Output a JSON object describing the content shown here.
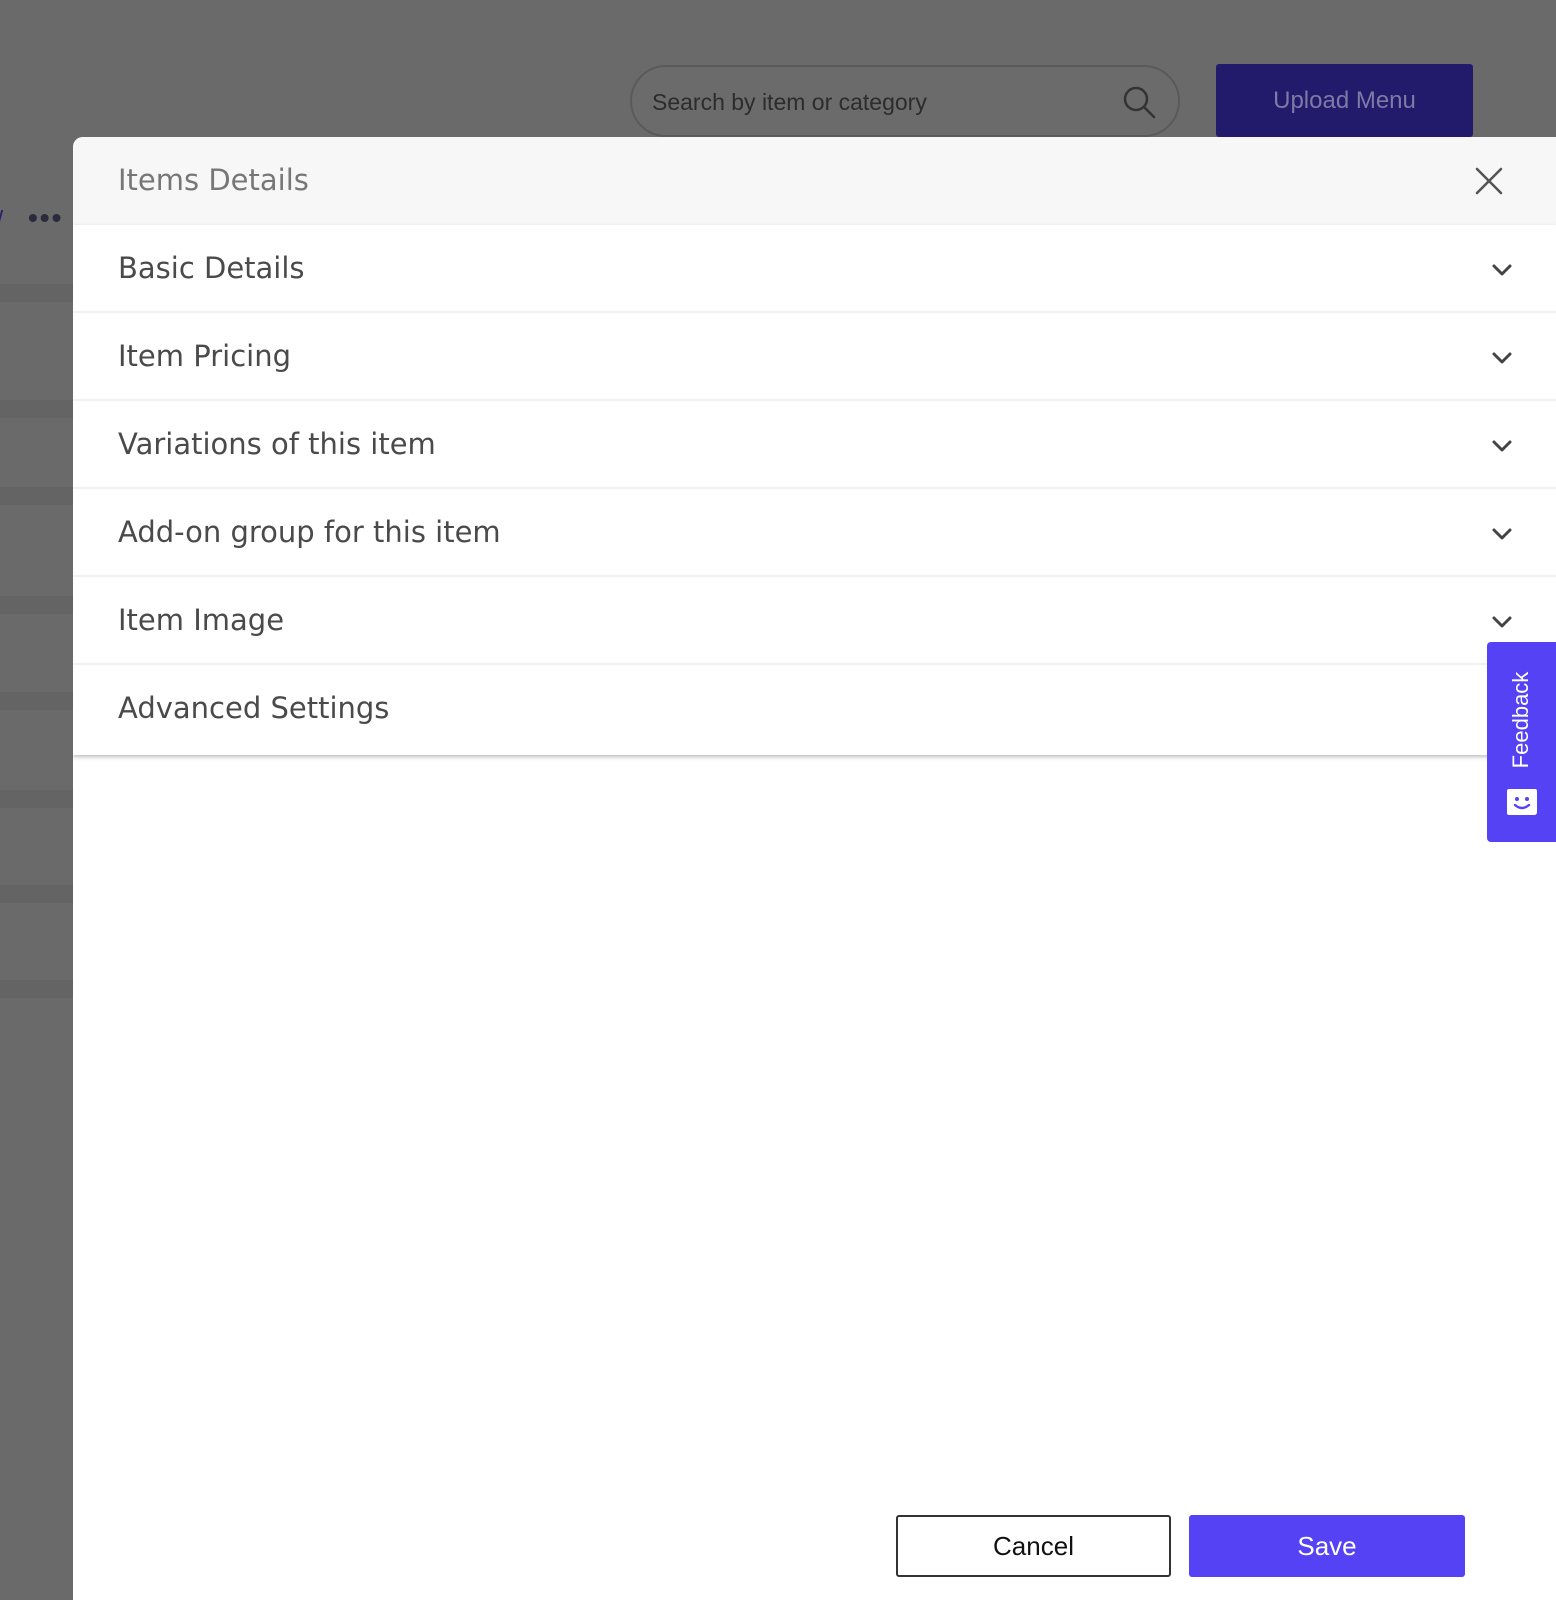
{
  "background": {
    "search": {
      "placeholder": "Search by item or category",
      "icon": "search-icon"
    },
    "upload_button": "Upload Menu",
    "more_icon": "ellipsis-icon"
  },
  "modal": {
    "title": "Items Details",
    "close_icon": "close-icon",
    "sections": [
      {
        "label": "Basic Details",
        "icon": "chevron-down-icon"
      },
      {
        "label": "Item Pricing",
        "icon": "chevron-down-icon"
      },
      {
        "label": "Variations of this item",
        "icon": "chevron-down-icon"
      },
      {
        "label": "Add-on group for this item",
        "icon": "chevron-down-icon"
      },
      {
        "label": "Item Image",
        "icon": "chevron-down-icon"
      },
      {
        "label": "Advanced Settings",
        "icon": "chevron-down-icon"
      }
    ],
    "cancel_label": "Cancel",
    "save_label": "Save"
  },
  "feedback": {
    "label": "Feedback",
    "icon": "chat-face-icon"
  },
  "colors": {
    "overlay": "#6a6a6a",
    "accent": "#5542f4",
    "upload_dimmed": "#221a6b",
    "header_bg": "#f7f7f7"
  }
}
